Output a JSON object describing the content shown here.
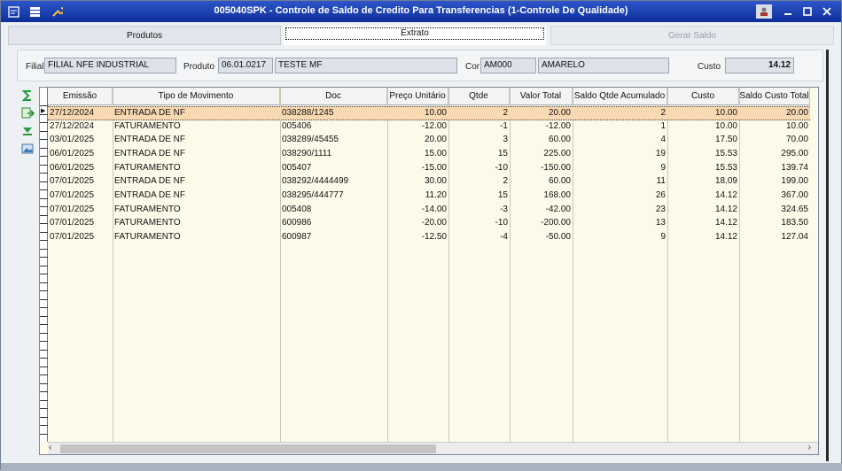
{
  "window": {
    "title": "005040SPK - Controle de Saldo de Credito Para Transferencias (1-Controle De Qualidade)",
    "icons": [
      "app-menu-icon",
      "tree-icon",
      "wrench-icon"
    ],
    "controls": [
      "user-icon",
      "minimize",
      "maximize",
      "close"
    ],
    "accent": "#1a3fb0"
  },
  "tabs": [
    {
      "label": "Produtos",
      "state": "normal"
    },
    {
      "label": "Extrato",
      "state": "active"
    },
    {
      "label": "Gerar Saldo",
      "state": "disabled"
    }
  ],
  "header": {
    "filial_label": "Filial",
    "filial_value": "FILIAL NFE INDUSTRIAL",
    "produto_label": "Produto",
    "produto_code": "06.01.0217",
    "produto_desc": "TESTE MF",
    "cor_label": "Cor",
    "cor_code": "AM000",
    "cor_desc": "AMARELO",
    "custo_label": "Custo",
    "custo_value": "14.12"
  },
  "toolbar": [
    "sum-icon",
    "export-icon",
    "download-icon",
    "image-icon"
  ],
  "grid": {
    "columns": [
      "Emissão",
      "Tipo de Movimento",
      "Doc",
      "Preço Unitário",
      "Qtde",
      "Valor Total",
      "Saldo Qtde Acumulado",
      "Custo",
      "Saldo Custo Total"
    ],
    "rows": [
      [
        "27/12/2024",
        "ENTRADA DE NF",
        "038288/1245",
        "10.00",
        "2",
        "20.00",
        "2",
        "10.00",
        "20.00"
      ],
      [
        "27/12/2024",
        "FATURAMENTO",
        "005406",
        "-12.00",
        "-1",
        "-12.00",
        "1",
        "10.00",
        "10.00"
      ],
      [
        "03/01/2025",
        "ENTRADA DE NF",
        "038289/45455",
        "20.00",
        "3",
        "60.00",
        "4",
        "17.50",
        "70.00"
      ],
      [
        "06/01/2025",
        "ENTRADA DE NF",
        "038290/1111",
        "15.00",
        "15",
        "225.00",
        "19",
        "15.53",
        "295.00"
      ],
      [
        "06/01/2025",
        "FATURAMENTO",
        "005407",
        "-15.00",
        "-10",
        "-150.00",
        "9",
        "15.53",
        "139.74"
      ],
      [
        "07/01/2025",
        "ENTRADA DE NF",
        "038292/4444499",
        "30.00",
        "2",
        "60.00",
        "11",
        "18.09",
        "199.00"
      ],
      [
        "07/01/2025",
        "ENTRADA DE NF",
        "038295/444777",
        "11.20",
        "15",
        "168.00",
        "26",
        "14.12",
        "367.00"
      ],
      [
        "07/01/2025",
        "FATURAMENTO",
        "005408",
        "-14.00",
        "-3",
        "-42.00",
        "23",
        "14.12",
        "324.65"
      ],
      [
        "07/01/2025",
        "FATURAMENTO",
        "600986",
        "-20.00",
        "-10",
        "-200.00",
        "13",
        "14.12",
        "183.50"
      ],
      [
        "07/01/2025",
        "FATURAMENTO",
        "600987",
        "-12.50",
        "-4",
        "-50.00",
        "9",
        "14.12",
        "127.04"
      ]
    ],
    "selected_row": 0
  }
}
